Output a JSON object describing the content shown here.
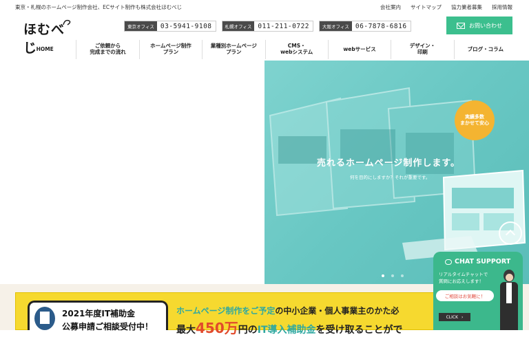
{
  "header": {
    "tagline": "東京・札幌のホームページ制作会社、ECサイト制作も株式会社ほむべじ",
    "top_links": [
      "会社案内",
      "サイトマップ",
      "協力業者募集",
      "採用情報"
    ],
    "logo_text": "ほむべじ",
    "phones": [
      {
        "label": "東京オフィス",
        "number": "03-5941-9108"
      },
      {
        "label": "札幌オフィス",
        "number": "011-211-0722"
      },
      {
        "label": "大阪オフィス",
        "number": "06-7878-6816"
      }
    ],
    "contact_button": "お問い合わせ"
  },
  "nav": {
    "items": [
      "HOME",
      "ご依頼から\n完成までの流れ",
      "ホームページ制作\nプラン",
      "業種別ホームページ\nプラン",
      "CMS・\nwebシステム",
      "webサービス",
      "デザイン・\n印刷",
      "ブログ・コラム"
    ]
  },
  "hero": {
    "headline": "売れるホームページ制作します。",
    "subline": "何を目的にしますか？それが重要です。",
    "badge": "実績多数\nまかせて安心",
    "slide_count": 3,
    "active_slide": 1
  },
  "promo": {
    "card_line1": "2021年度IT補助金",
    "card_line2": "公募申請ご相談受付中！",
    "line1_highlight": "ホームページ制作をご予定",
    "line1_rest": "の中小企業・個人事業主のかた必",
    "line2_prefix": "最大",
    "line2_amount": "450万",
    "line2_mid": "円の",
    "line2_highlight": "IT導入補助金",
    "line2_rest": "を受け取ることがで"
  },
  "chat": {
    "title": "CHAT SUPPORT",
    "text": "リアルタイムチャットで\n質問にお応えします！",
    "pill": "ご相談はお気軽に！",
    "click": "CLICK"
  },
  "colors": {
    "accent_green": "#3cbf8e",
    "hero_teal": "#68c7c3",
    "badge_orange": "#f4b431",
    "promo_yellow": "#f6d92f",
    "highlight_red": "#e24b2c",
    "highlight_teal": "#2fa8a0"
  }
}
